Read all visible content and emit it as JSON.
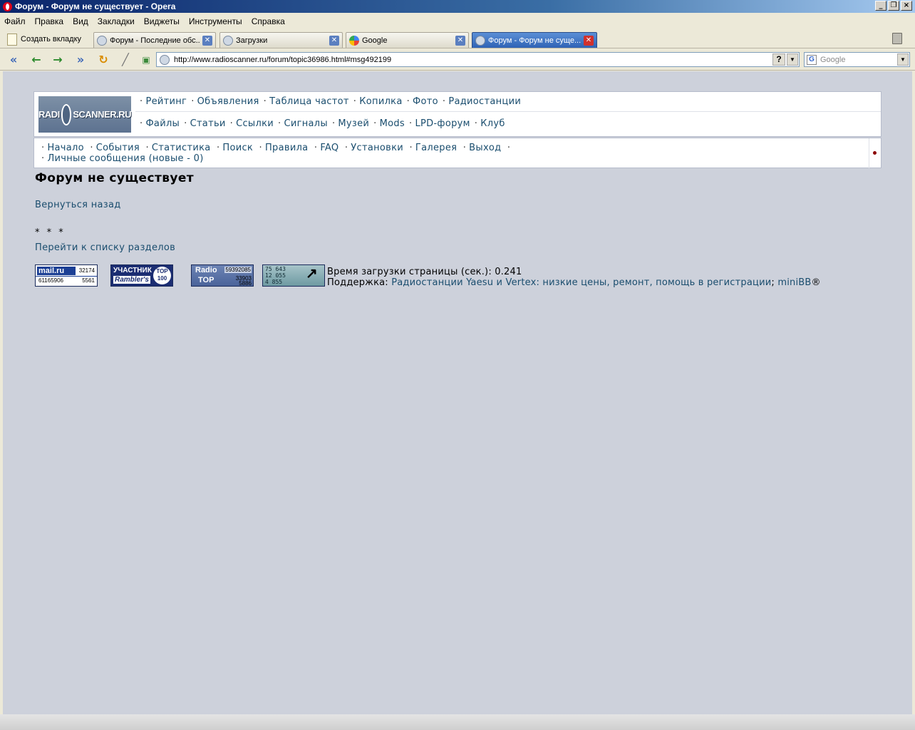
{
  "window": {
    "title": "Форум - Форум не существует - Opera",
    "controls": [
      "_",
      "❐",
      "×"
    ]
  },
  "menubar": [
    "Файл",
    "Правка",
    "Вид",
    "Закладки",
    "Виджеты",
    "Инструменты",
    "Справка"
  ],
  "tabs": {
    "new_tab_label": "Создать вкладку",
    "items": [
      {
        "label": "Форум - Последние обс...",
        "active": false
      },
      {
        "label": "Загрузки",
        "active": false
      },
      {
        "label": "Google",
        "active": false
      },
      {
        "label": "Форум - Форум не суще...",
        "active": true
      }
    ]
  },
  "address": {
    "url": "http://www.radioscanner.ru/forum/topic36986.html#msg492199",
    "help_label": "?",
    "search_placeholder": "Google"
  },
  "site": {
    "logo_left": "RADI",
    "logo_right": "SCANNER.RU",
    "nav_row1": [
      "Рейтинг",
      "Объявления",
      "Таблица частот",
      "Копилка",
      "Фото",
      "Радиостанции"
    ],
    "nav_row2": [
      "Файлы",
      "Статьи",
      "Ссылки",
      "Сигналы",
      "Музей",
      "Mods",
      "LPD-форум",
      "Клуб"
    ],
    "user_row1": [
      "Начало",
      "События",
      "Статистика",
      "Поиск",
      "Правила",
      "FAQ",
      "Установки",
      "Галерея",
      "Выход"
    ],
    "pm_label": "Личные сообщения",
    "pm_count": "(новые - 0)"
  },
  "content": {
    "title": "Форум не существует",
    "back_link": "Вернуться назад",
    "stars": "* * *",
    "sections_link": "Перейти к списку разделов"
  },
  "counters": {
    "mail": {
      "brand": "mail.ru",
      "n1": "32174",
      "n2": "61165906",
      "n3": "5561"
    },
    "rambler": {
      "line1": "УЧАСТНИК",
      "line2": "Rambler's",
      "badge": "TOP 100"
    },
    "radio": {
      "line1": "Radio",
      "line2": "TOP",
      "n1": "59392085",
      "n2": "33903",
      "n3": "5886"
    },
    "li": {
      "lines": [
        "75 643",
        "12 055",
        "4 855"
      ]
    }
  },
  "footer": {
    "load_time_label": "Время загрузки страницы (сек.): 0.241",
    "support_label": "Поддержка:",
    "support_link": "Радиостанции Yaesu и Vertex: низкие цены, ремонт, помощь в регистрации",
    "separator": ";",
    "minibb_link": "miniBB",
    "reg_mark": "®"
  }
}
